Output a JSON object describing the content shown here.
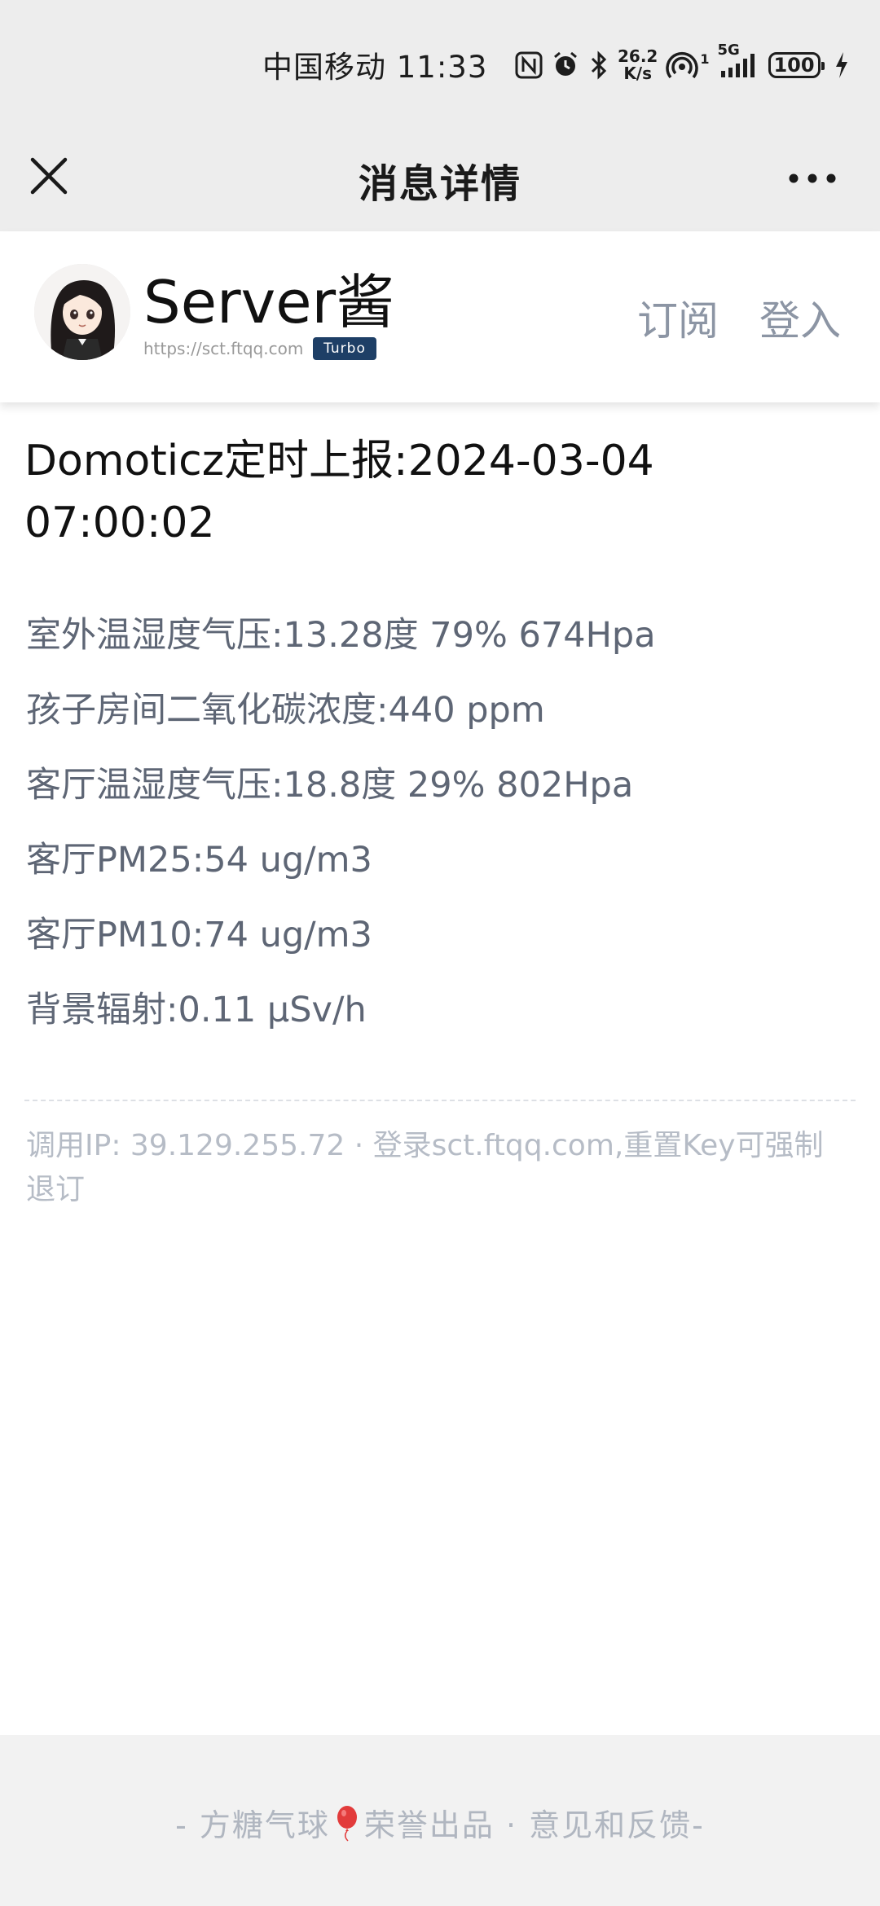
{
  "status_bar": {
    "carrier_time": "中国移动 11:33",
    "speed_value": "26.2",
    "speed_unit": "K/s",
    "battery": "100",
    "sim_index": "1",
    "network": "5G"
  },
  "nav": {
    "title": "消息详情"
  },
  "site": {
    "name": "Server酱",
    "url": "https://sct.ftqq.com",
    "badge": "Turbo",
    "subscribe_label": "订阅",
    "login_label": "登入"
  },
  "message": {
    "title": "Domoticz定时上报:2024-03-04 07:00:02",
    "lines": [
      "室外温湿度气压:13.28度 79% 674Hpa",
      "孩子房间二氧化碳浓度:440 ppm",
      "客厅温湿度气压:18.8度 29% 802Hpa",
      "客厅PM25:54 ug/m3",
      "客厅PM10:74 ug/m3",
      "背景辐射:0.11 μSv/h"
    ],
    "footnote": "调用IP: 39.129.255.72 · 登录sct.ftqq.com,重置Key可强制退订"
  },
  "footer": {
    "prefix": "- 方糖气球",
    "suffix": "荣誉出品 · 意见和反馈-"
  }
}
